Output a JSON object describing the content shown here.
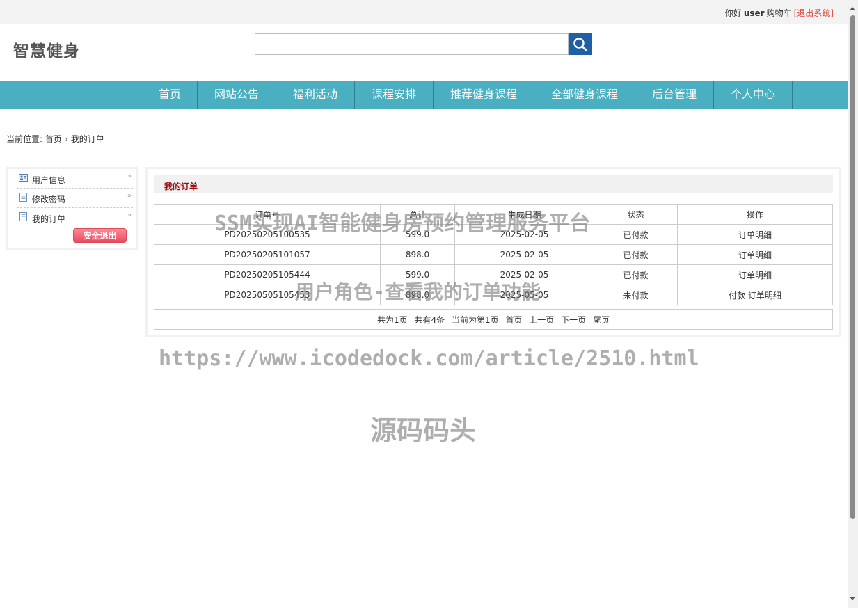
{
  "topbar": {
    "greeting": "你好",
    "username": "user",
    "cart_label": "购物车",
    "logout_label": "[退出系统]"
  },
  "header": {
    "logo": "智慧健身",
    "search": {
      "value": "",
      "placeholder": ""
    },
    "search_icon": "search-icon"
  },
  "nav": {
    "items": [
      {
        "label": "首页"
      },
      {
        "label": "网站公告"
      },
      {
        "label": "福利活动"
      },
      {
        "label": "课程安排"
      },
      {
        "label": "推荐健身课程"
      },
      {
        "label": "全部健身课程"
      },
      {
        "label": "后台管理"
      },
      {
        "label": "个人中心"
      }
    ]
  },
  "breadcrumb": {
    "prefix": "当前位置:",
    "home": "首页",
    "separator": "›",
    "current": "我的订单"
  },
  "sidebar": {
    "items": [
      {
        "label": "用户信息",
        "icon": "user-card-icon"
      },
      {
        "label": "修改密码",
        "icon": "document-icon"
      },
      {
        "label": "我的订单",
        "icon": "document-icon"
      }
    ],
    "exit_button": "安全退出"
  },
  "main": {
    "title": "我的订单",
    "table": {
      "headers": [
        "订单号",
        "总计",
        "生成日期",
        "状态",
        "操作"
      ],
      "rows": [
        {
          "order_no": "PD20250205100535",
          "total": "599.0",
          "date": "2025-02-05",
          "status": "已付款",
          "pay": "",
          "detail": "订单明细"
        },
        {
          "order_no": "PD20250205101057",
          "total": "898.0",
          "date": "2025-02-05",
          "status": "已付款",
          "pay": "",
          "detail": "订单明细"
        },
        {
          "order_no": "PD20250205105444",
          "total": "599.0",
          "date": "2025-02-05",
          "status": "已付款",
          "pay": "",
          "detail": "订单明细"
        },
        {
          "order_no": "PD20250505105453",
          "total": "898.0",
          "date": "2025-05-05",
          "status": "未付款",
          "pay": "付款",
          "detail": "订单明细"
        }
      ]
    },
    "pager": {
      "total_pages": "共为1页",
      "total_items": "共有4条",
      "current_page": "当前为第1页",
      "first": "首页",
      "prev": "上一页",
      "next": "下一页",
      "last": "尾页"
    }
  },
  "watermark": {
    "line1": "SSM实现AI智能健身房预约管理服务平台",
    "line2": "用户角色-查看我的订单功能",
    "line3": "https://www.icodedock.com/article/2510.html",
    "line4": "源码码头"
  },
  "colors": {
    "nav_bg": "#49afc1",
    "search_btn": "#1f5fa6",
    "title_red": "#9c1010",
    "logout_red": "#e0463c"
  }
}
